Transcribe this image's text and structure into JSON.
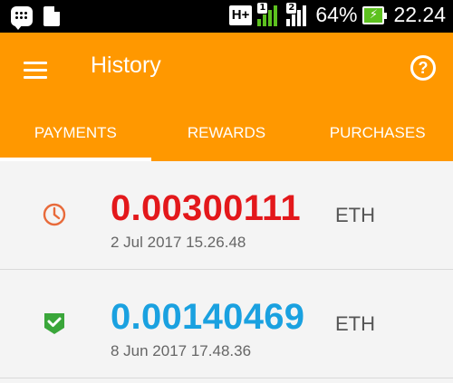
{
  "status_bar": {
    "network": "H+",
    "sim_slot_1": "1",
    "sim_slot_2": "2",
    "battery_percent": "64%",
    "time": "22.24",
    "battery_color": "#5dc11f"
  },
  "header": {
    "title": "History",
    "menu_icon": "hamburger-menu-icon",
    "help_icon": "help-circle-icon",
    "background": "#ff9800"
  },
  "tabs": [
    {
      "label": "PAYMENTS",
      "active": true
    },
    {
      "label": "REWARDS",
      "active": false
    },
    {
      "label": "PURCHASES",
      "active": false
    }
  ],
  "transactions": [
    {
      "amount": "0.00300111",
      "unit": "ETH",
      "date": "2 Jul 2017 15.26.48",
      "status_icon": "clock-icon",
      "amount_color": "#e3181b",
      "icon_color": "#e86a3a"
    },
    {
      "amount": "0.00140469",
      "unit": "ETH",
      "date": "8 Jun 2017 17.48.36",
      "status_icon": "shield-check-icon",
      "amount_color": "#1aa1e0",
      "icon_color": "#3aa63a"
    }
  ]
}
